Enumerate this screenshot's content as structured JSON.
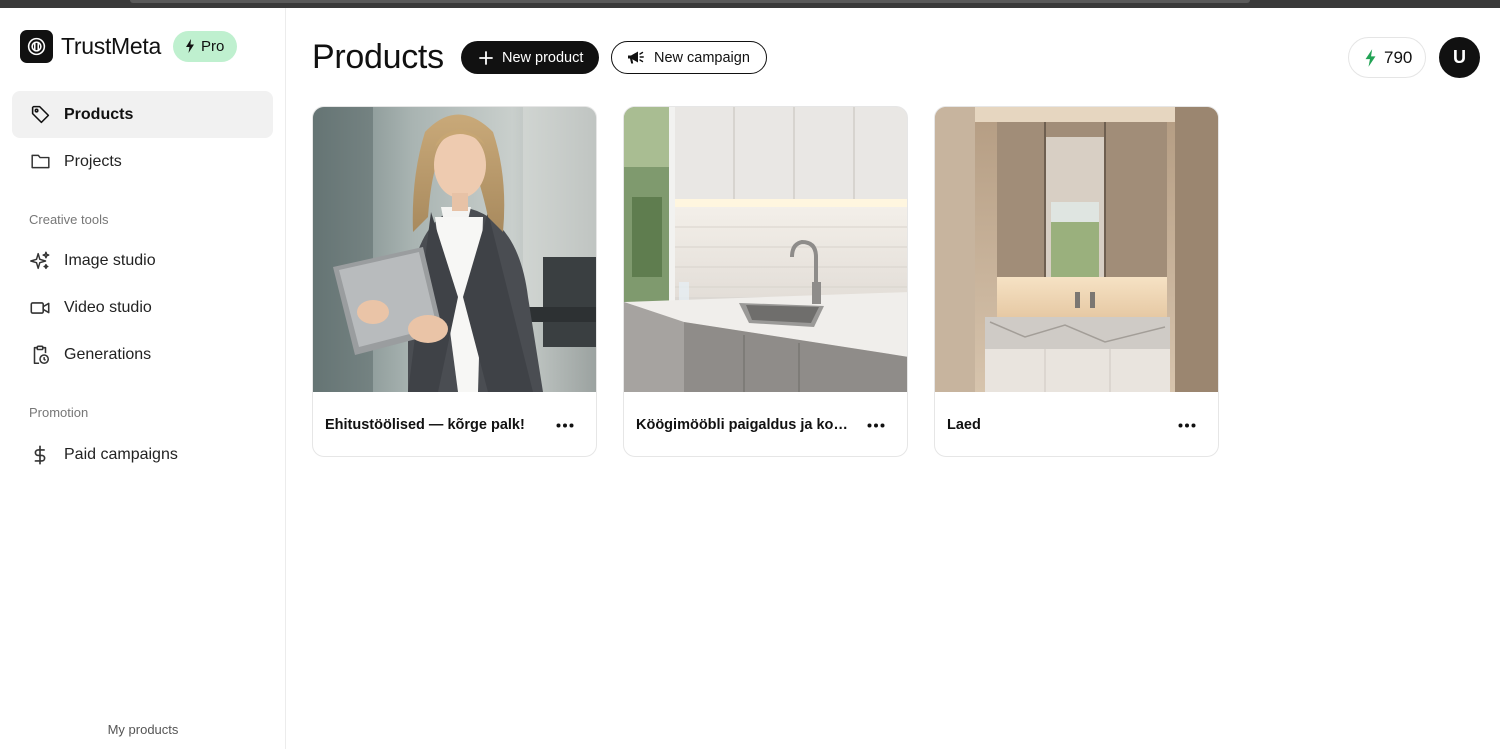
{
  "app": {
    "name": "TrustMeta",
    "plan_badge": "Pro"
  },
  "sidebar": {
    "nav_main": [
      {
        "label": "Products",
        "icon": "tag-icon",
        "active": true
      },
      {
        "label": "Projects",
        "icon": "folder-icon",
        "active": false
      }
    ],
    "creative_tools_label": "Creative tools",
    "creative_tools": [
      {
        "label": "Image studio",
        "icon": "sparkles-icon"
      },
      {
        "label": "Video studio",
        "icon": "video-camera-icon"
      },
      {
        "label": "Generations",
        "icon": "clipboard-clock-icon"
      }
    ],
    "promotion_label": "Promotion",
    "promotion": [
      {
        "label": "Paid campaigns",
        "icon": "dollar-icon"
      }
    ],
    "footer_label": "My products"
  },
  "header": {
    "title": "Products",
    "new_product_label": "New product",
    "new_campaign_label": "New campaign",
    "credits": "790",
    "avatar_initial": "U"
  },
  "products": [
    {
      "title": "Ehitustöölised — kõrge palk!",
      "image": "woman-with-tablet-photo"
    },
    {
      "title": "Köögimööbli paigaldus ja kokk...",
      "image": "kitchen-sink-photo"
    },
    {
      "title": "Laed",
      "image": "bathroom-vanity-photo"
    }
  ],
  "colors": {
    "accent_dark": "#111111",
    "pro_badge_bg": "#bff0cf",
    "lightning_green": "#22a355",
    "active_nav_bg": "#f1f1f1"
  }
}
